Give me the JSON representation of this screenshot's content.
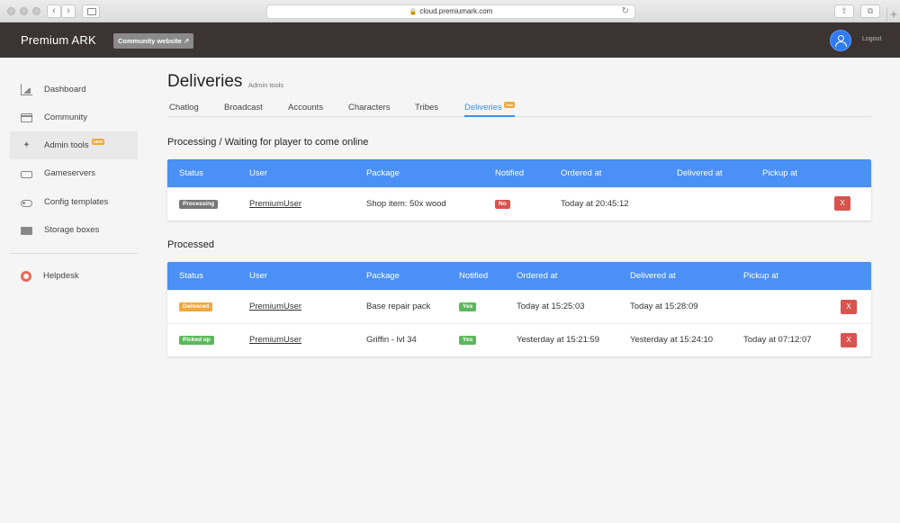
{
  "browser": {
    "url": "cloud.premiumark.com"
  },
  "app": {
    "brand": "Premium ARK",
    "community_button": "Community website",
    "logout": "Logout"
  },
  "sidebar": {
    "items": [
      {
        "label": "Dashboard",
        "icon": "chart-icon"
      },
      {
        "label": "Community",
        "icon": "window-icon"
      },
      {
        "label": "Admin tools",
        "icon": "wand-icon",
        "badge": "NEW",
        "active": true
      },
      {
        "label": "Gameservers",
        "icon": "drive-icon"
      },
      {
        "label": "Config templates",
        "icon": "toggle-icon"
      },
      {
        "label": "Storage boxes",
        "icon": "folder-icon"
      },
      {
        "label": "Helpdesk",
        "icon": "lifebuoy-icon"
      }
    ]
  },
  "page": {
    "title": "Deliveries",
    "subtitle": "Admin tools",
    "tabs": [
      {
        "label": "Chatlog"
      },
      {
        "label": "Broadcast"
      },
      {
        "label": "Accounts"
      },
      {
        "label": "Characters"
      },
      {
        "label": "Tribes"
      },
      {
        "label": "Deliveries",
        "badge": "Test",
        "active": true
      }
    ]
  },
  "processing": {
    "title": "Processing / Waiting for player to come online",
    "headers": [
      "Status",
      "User",
      "Package",
      "Notified",
      "Ordered at",
      "Delivered at",
      "Pickup at"
    ],
    "rows": [
      {
        "status": "Processing",
        "user": "PremiumUser",
        "package": "Shop item: 50x wood",
        "notified": "No",
        "ordered": "Today at 20:45:12",
        "delivered": "",
        "pickup": "",
        "action": "X"
      }
    ]
  },
  "processed": {
    "title": "Processed",
    "headers": [
      "Status",
      "User",
      "Package",
      "Notified",
      "Ordered at",
      "Delivered at",
      "Pickup at"
    ],
    "rows": [
      {
        "status": "Delivered",
        "user": "PremiumUser",
        "package": "Base repair pack",
        "notified": "Yes",
        "ordered": "Today at 15:25:03",
        "delivered": "Today at 15:28:09",
        "pickup": "",
        "action": "X"
      },
      {
        "status": "Picked up",
        "user": "PremiumUser",
        "package": "Griffin - lvl 34",
        "notified": "Yes",
        "ordered": "Yesterday at 15:21:59",
        "delivered": "Yesterday at 15:24:10",
        "pickup": "Today at 07:12:07",
        "action": "X"
      }
    ]
  },
  "colors": {
    "header_blue": "#4a90f7",
    "processing_badge": "#777777",
    "delivered_badge": "#f0a83a",
    "picked_up_badge": "#5cb85c",
    "yes_badge": "#5cb85c",
    "no_badge": "#d9534f",
    "delete_button": "#d9534f"
  }
}
